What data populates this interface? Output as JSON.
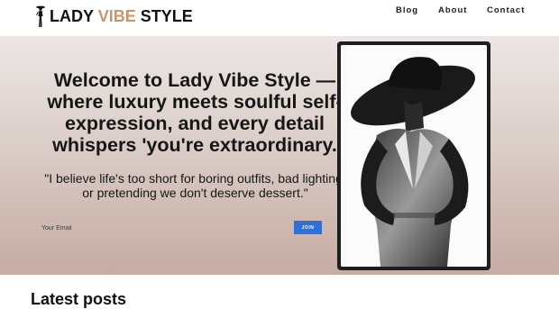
{
  "brand": {
    "name_part1": "LADY ",
    "name_accent": "VIBE",
    "name_part2": " STYLE",
    "accent_color": "#c8946a",
    "logo_icon": "fashion-woman-icon"
  },
  "nav": {
    "items": [
      {
        "label": "Blog"
      },
      {
        "label": "About"
      },
      {
        "label": "Contact"
      }
    ]
  },
  "hero": {
    "title": "Welcome to Lady Vibe Style — where luxury meets soulful self-expression, and every detail whispers 'you're extraordinary.",
    "quote": "\"I believe life's too short for boring outfits, bad lighting, or pretending we don't deserve dessert.\"",
    "email_placeholder": "Your Email",
    "join_label": "JOIN",
    "join_color": "#2f6fd6",
    "image_icon": "woman-in-hat-photo"
  },
  "latest": {
    "heading": "Latest posts"
  }
}
